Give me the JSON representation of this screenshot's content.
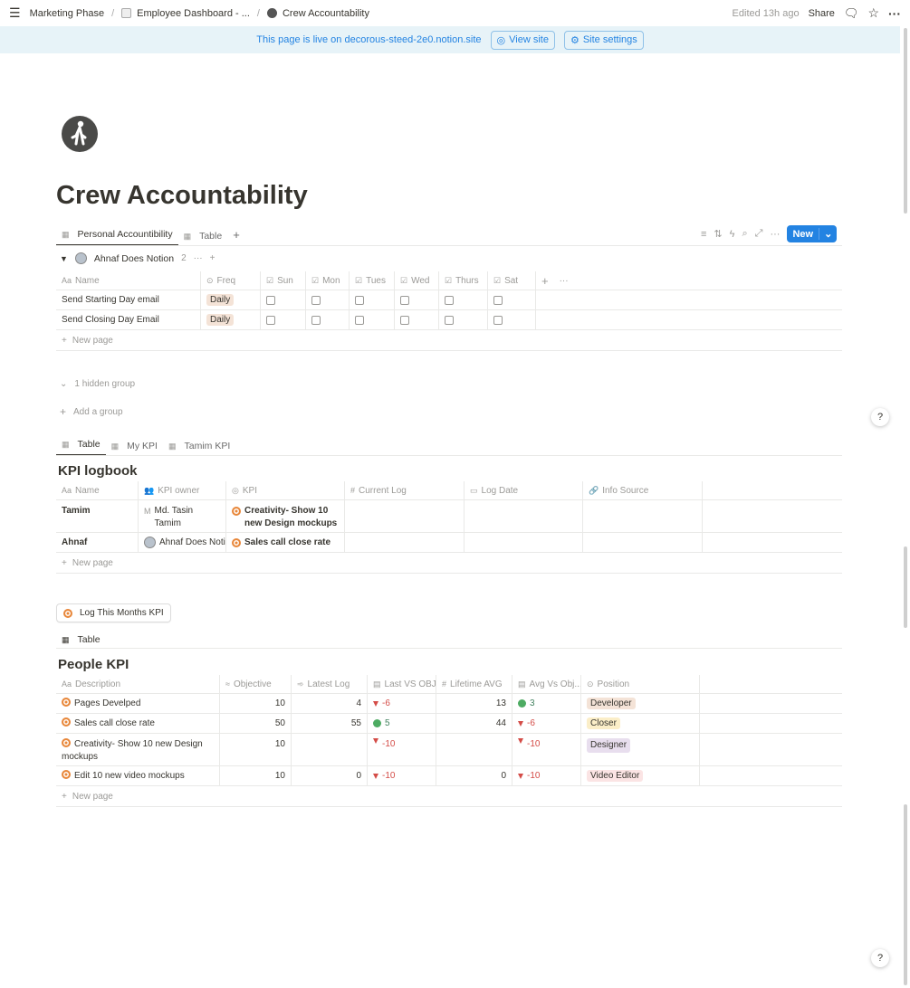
{
  "breadcrumb": {
    "items": [
      "Marketing Phase",
      "Employee Dashboard - ...",
      "Crew Accountability"
    ]
  },
  "topbar": {
    "edited": "Edited 13h ago",
    "share": "Share"
  },
  "banner": {
    "message": "This page is live on decorous-steed-2e0.notion.site",
    "view_site": "View site",
    "site_settings": "Site settings"
  },
  "page": {
    "title": "Crew Accountability"
  },
  "db1": {
    "views": [
      "Personal Accountibility",
      "Table"
    ],
    "new_label": "New",
    "group": {
      "name": "Ahnaf Does Notion",
      "count": "2"
    },
    "columns": [
      "Name",
      "Freq",
      "Sun",
      "Mon",
      "Tues",
      "Wed",
      "Thurs",
      "Sat"
    ],
    "rows": [
      {
        "name": "Send Starting Day email",
        "freq": "Daily"
      },
      {
        "name": "Send Closing Day Email",
        "freq": "Daily"
      }
    ],
    "new_page": "New page",
    "hidden_group": "1 hidden group",
    "add_group": "Add a group"
  },
  "db2": {
    "views": [
      "Table",
      "My KPI",
      "Tamim KPI"
    ],
    "title": "KPI logbook",
    "columns": [
      "Name",
      "KPI owner",
      "KPI",
      "Current Log",
      "Log Date",
      "Info Source"
    ],
    "rows": [
      {
        "name": "Tamim",
        "owner_initial": "M",
        "owner": "Md. Tasin Tamim",
        "kpi": "Creativity- Show 10 new Design mockups"
      },
      {
        "name": "Ahnaf",
        "owner": "Ahnaf Does Notion",
        "kpi": "Sales call close rate"
      }
    ],
    "new_page": "New page"
  },
  "button": {
    "label": "Log This Months KPI"
  },
  "db3": {
    "views": [
      "Table"
    ],
    "title": "People KPI",
    "columns": [
      "Description",
      "Objective",
      "Latest Log",
      "Last VS OBJ",
      "Lifetime AVG",
      "Avg Vs Obj...",
      "Position"
    ],
    "rows": [
      {
        "desc": "Pages Develped",
        "objective": "10",
        "latest": "4",
        "last_vs": "-6",
        "last_vs_status": "down",
        "lifetime": "13",
        "avg_vs": "3",
        "avg_vs_status": "up",
        "position": "Developer",
        "position_color": "#f4e3d7"
      },
      {
        "desc": "Sales call close rate",
        "objective": "50",
        "latest": "55",
        "last_vs": "5",
        "last_vs_status": "up",
        "lifetime": "44",
        "avg_vs": "-6",
        "avg_vs_status": "down",
        "position": "Closer",
        "position_color": "#fbeec8"
      },
      {
        "desc": "Creativity- Show  10 new Design mockups",
        "objective": "10",
        "latest": "",
        "last_vs": "-10",
        "last_vs_status": "down",
        "lifetime": "",
        "avg_vs": "-10",
        "avg_vs_status": "down",
        "position": "Designer",
        "position_color": "#e8deee"
      },
      {
        "desc": "Edit 10 new video mockups",
        "objective": "10",
        "latest": "0",
        "last_vs": "-10",
        "last_vs_status": "down",
        "lifetime": "0",
        "avg_vs": "-10",
        "avg_vs_status": "down",
        "position": "Video Editor",
        "position_color": "#fbe4e4"
      }
    ],
    "new_page": "New page"
  }
}
